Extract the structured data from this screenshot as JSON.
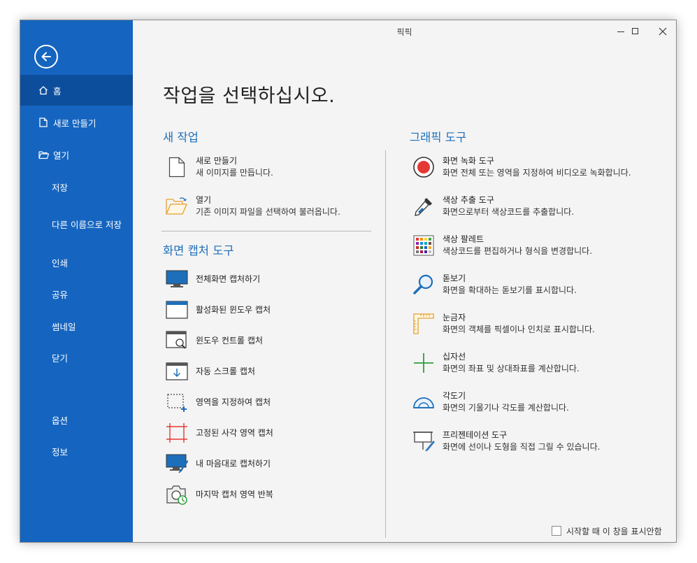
{
  "window": {
    "title": "픽픽"
  },
  "sidebar": {
    "items": [
      {
        "label": "홈",
        "icon": "home-icon",
        "selected": true
      },
      {
        "label": "새로 만들기",
        "icon": "new-file-icon"
      },
      {
        "label": "열기",
        "icon": "folder-open-icon"
      },
      {
        "label": "저장"
      },
      {
        "label": "다른 이름으로 저장"
      },
      {
        "label": "인쇄"
      },
      {
        "label": "공유"
      },
      {
        "label": "썸네일"
      },
      {
        "label": "닫기"
      },
      {
        "label": "옵션"
      },
      {
        "label": "정보"
      }
    ]
  },
  "main": {
    "heading": "작업을 선택하십시오.",
    "new_task": {
      "title": "새 작업",
      "items": [
        {
          "title": "새로 만들기",
          "desc": "새 이미지를 만듭니다.",
          "icon": "blank-document-icon"
        },
        {
          "title": "열기",
          "desc": "기존 이미지 파일을 선택하여 불러옵니다.",
          "icon": "open-folder-icon"
        }
      ]
    },
    "capture_tools": {
      "title": "화면 캡처 도구",
      "items": [
        {
          "label": "전체화면 캡처하기",
          "icon": "monitor-icon"
        },
        {
          "label": "활성화된 윈도우 캡처",
          "icon": "window-icon"
        },
        {
          "label": "윈도우 컨트롤 캡처",
          "icon": "window-magnifier-icon"
        },
        {
          "label": "자동 스크롤 캡처",
          "icon": "scroll-capture-icon"
        },
        {
          "label": "영역을 지정하여 캡처",
          "icon": "region-select-icon"
        },
        {
          "label": "고정된 사각 영역 캡처",
          "icon": "fixed-region-icon"
        },
        {
          "label": "내 마음대로 캡처하기",
          "icon": "freehand-monitor-icon"
        },
        {
          "label": "마지막 캡처 영역 반복",
          "icon": "repeat-camera-icon"
        }
      ]
    },
    "graphic_tools": {
      "title": "그래픽 도구",
      "items": [
        {
          "title": "화면 녹화 도구",
          "desc": "화면 전체 또는 영역을 지정하여 비디오로 녹화합니다.",
          "icon": "record-icon"
        },
        {
          "title": "색상 추출 도구",
          "desc": "화면으로부터 색상코드를 추출합니다.",
          "icon": "eyedropper-icon"
        },
        {
          "title": "색상 팔레트",
          "desc": "색상코드를 편집하거나 형식을 변경합니다.",
          "icon": "color-palette-icon"
        },
        {
          "title": "돋보기",
          "desc": "화면을 확대하는 돋보기를 표시합니다.",
          "icon": "magnifier-icon"
        },
        {
          "title": "눈금자",
          "desc": "화면의 객체를 픽셀이나 인치로 표시합니다.",
          "icon": "ruler-icon"
        },
        {
          "title": "십자선",
          "desc": "화면의 좌표 및 상대좌표를 계산합니다.",
          "icon": "crosshair-icon"
        },
        {
          "title": "각도기",
          "desc": "화면의 기울기나 각도를 계산합니다.",
          "icon": "protractor-icon"
        },
        {
          "title": "프리젠테이션 도구",
          "desc": "화면에 선이나 도형을 직접 그릴 수 있습니다.",
          "icon": "whiteboard-icon"
        }
      ]
    },
    "startup_checkbox": {
      "label": "시작할 때 이 창을 표시안함",
      "checked": false
    }
  },
  "colors": {
    "sidebar": "#1565c0",
    "sidebar_selected": "#0d4e9c",
    "accent_text": "#1e6fba",
    "record_red": "#e53935"
  }
}
